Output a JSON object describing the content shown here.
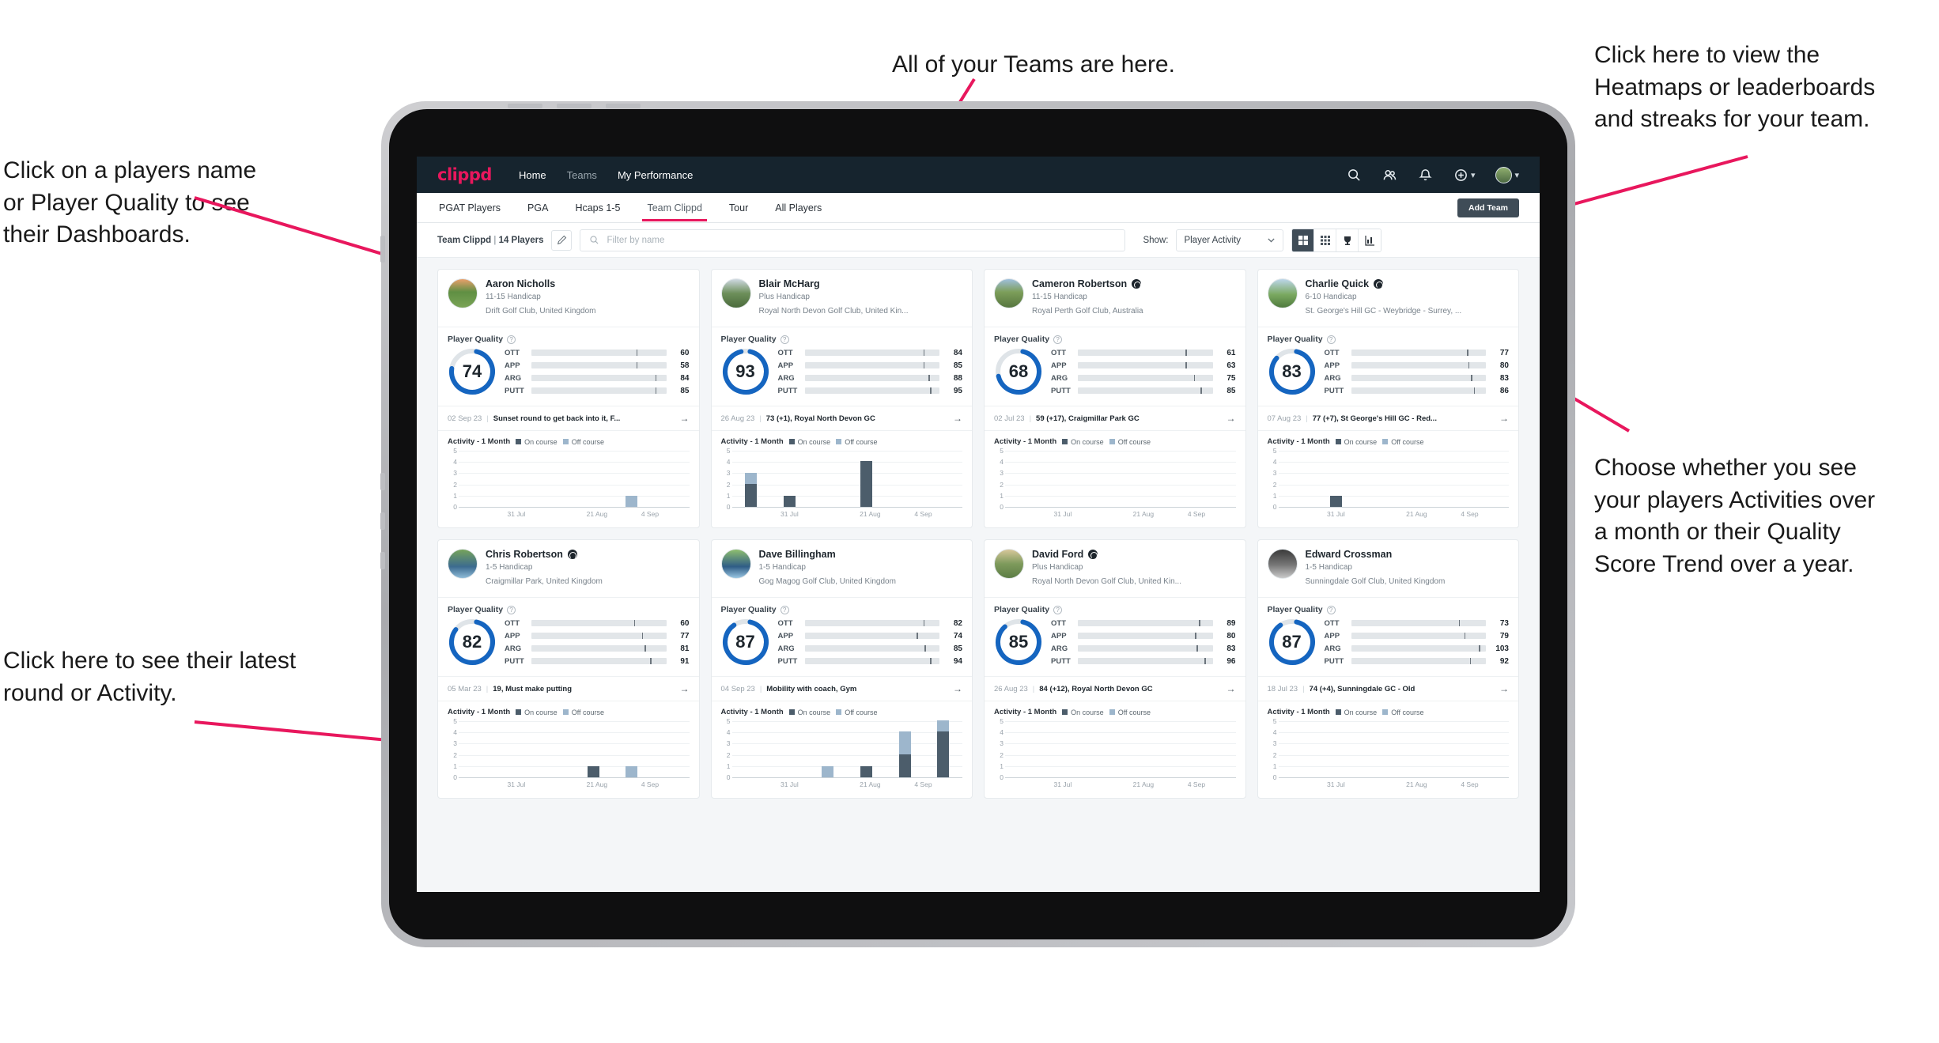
{
  "annotations": [
    {
      "id": "teams",
      "text": "All of your Teams are here."
    },
    {
      "id": "heatmaps",
      "text": "Click here to view the\nHeatmaps or leaderboards\nand streaks for your team."
    },
    {
      "id": "players",
      "text": "Click on a players name\nor Player Quality to see\ntheir Dashboards."
    },
    {
      "id": "activity-toggle",
      "text": "Choose whether you see\nyour players Activities over\na month or their Quality\nScore Trend over a year."
    },
    {
      "id": "latest-round",
      "text": "Click here to see their latest\nround or Activity."
    }
  ],
  "nav": {
    "logo": "clippd",
    "links": [
      {
        "label": "Home",
        "active": true
      },
      {
        "label": "Teams",
        "active": false
      },
      {
        "label": "My Performance",
        "active": true
      }
    ],
    "icons": [
      "search-icon",
      "people-icon",
      "bell-icon",
      "plus-circle-icon",
      "avatar"
    ]
  },
  "tabs": [
    {
      "label": "PGAT Players",
      "active": false
    },
    {
      "label": "PGA",
      "active": false
    },
    {
      "label": "Hcaps 1-5",
      "active": false
    },
    {
      "label": "Team Clippd",
      "active": true
    },
    {
      "label": "Tour",
      "active": false
    },
    {
      "label": "All Players",
      "active": false
    }
  ],
  "add_team_label": "Add Team",
  "toolbar": {
    "team_name": "Team Clippd",
    "separator": "|",
    "player_count": "14 Players",
    "search_placeholder": "Filter by name",
    "show_label": "Show:",
    "show_value": "Player Activity",
    "view_buttons": [
      "grid-large-icon",
      "grid-small-icon",
      "trophy-icon",
      "chart-icon"
    ]
  },
  "colors": {
    "accent": "#e8175d",
    "nav_bg": "#16242e",
    "donut": "#1565c0",
    "ott": "#f5a800",
    "app": "#3fd8b0",
    "arg": "#f4176b",
    "putt": "#a915c8",
    "on_course": "#4c5d6b",
    "off_course": "#9db6cc"
  },
  "section_labels": {
    "player_quality": "Player Quality",
    "activity_title": "Activity - 1 Month",
    "legend_on": "On course",
    "legend_off": "Off course"
  },
  "chart_data": {
    "type": "bar",
    "title": "Activity - 1 Month",
    "xlabel": "",
    "ylabel": "",
    "ylim": [
      0,
      5
    ],
    "yticks": [
      0,
      1,
      2,
      3,
      4,
      5
    ],
    "xticks": [
      "31 Jul",
      "21 Aug",
      "4 Sep"
    ],
    "series_names": [
      "On course",
      "Off course"
    ],
    "grid": true,
    "legend": "top"
  },
  "players": [
    {
      "name": "Aaron Nicholls",
      "verified": false,
      "handicap": "11-15 Handicap",
      "club": "Drift Golf Club, United Kingdom",
      "quality": 74,
      "metrics": [
        {
          "name": "OTT",
          "value": 60,
          "fill_pct": 60,
          "tick_pct": 78,
          "color": "#f5a800"
        },
        {
          "name": "APP",
          "value": 58,
          "fill_pct": 58,
          "tick_pct": 78,
          "color": "#3fd8b0"
        },
        {
          "name": "ARG",
          "value": 84,
          "fill_pct": 84,
          "tick_pct": 92,
          "color": "#f4176b"
        },
        {
          "name": "PUTT",
          "value": 85,
          "fill_pct": 85,
          "tick_pct": 92,
          "color": "#a915c8"
        }
      ],
      "round_date": "02 Sep 23",
      "round_text": "Sunset round to get back into it, F...",
      "bars": [
        {
          "on": 0,
          "off": 0
        },
        {
          "on": 0,
          "off": 0
        },
        {
          "on": 0,
          "off": 0
        },
        {
          "on": 0,
          "off": 0
        },
        {
          "on": 0,
          "off": 1
        },
        {
          "on": 0,
          "off": 0
        }
      ]
    },
    {
      "name": "Blair McHarg",
      "verified": false,
      "handicap": "Plus Handicap",
      "club": "Royal North Devon Golf Club, United Kin...",
      "quality": 93,
      "metrics": [
        {
          "name": "OTT",
          "value": 84,
          "fill_pct": 74,
          "tick_pct": 88,
          "color": "#f5a800"
        },
        {
          "name": "APP",
          "value": 85,
          "fill_pct": 74,
          "tick_pct": 88,
          "color": "#3fd8b0"
        },
        {
          "name": "ARG",
          "value": 88,
          "fill_pct": 84,
          "tick_pct": 92,
          "color": "#f4176b"
        },
        {
          "name": "PUTT",
          "value": 95,
          "fill_pct": 86,
          "tick_pct": 93,
          "color": "#a915c8"
        }
      ],
      "round_date": "26 Aug 23",
      "round_text": "73 (+1), Royal North Devon GC",
      "bars": [
        {
          "on": 2,
          "off": 1
        },
        {
          "on": 1,
          "off": 0
        },
        {
          "on": 0,
          "off": 0
        },
        {
          "on": 4,
          "off": 0
        },
        {
          "on": 0,
          "off": 0
        },
        {
          "on": 0,
          "off": 0
        }
      ]
    },
    {
      "name": "Cameron Robertson",
      "verified": true,
      "handicap": "11-15 Handicap",
      "club": "Royal Perth Golf Club, Australia",
      "quality": 68,
      "metrics": [
        {
          "name": "OTT",
          "value": 61,
          "fill_pct": 61,
          "tick_pct": 80,
          "color": "#f5a800"
        },
        {
          "name": "APP",
          "value": 63,
          "fill_pct": 63,
          "tick_pct": 80,
          "color": "#3fd8b0"
        },
        {
          "name": "ARG",
          "value": 75,
          "fill_pct": 72,
          "tick_pct": 86,
          "color": "#f4176b"
        },
        {
          "name": "PUTT",
          "value": 85,
          "fill_pct": 82,
          "tick_pct": 91,
          "color": "#a915c8"
        }
      ],
      "round_date": "02 Jul 23",
      "round_text": "59 (+17), Craigmillar Park GC",
      "bars": [
        {
          "on": 0,
          "off": 0
        },
        {
          "on": 0,
          "off": 0
        },
        {
          "on": 0,
          "off": 0
        },
        {
          "on": 0,
          "off": 0
        },
        {
          "on": 0,
          "off": 0
        },
        {
          "on": 0,
          "off": 0
        }
      ]
    },
    {
      "name": "Charlie Quick",
      "verified": true,
      "handicap": "6-10 Handicap",
      "club": "St. George's Hill GC - Weybridge - Surrey, ...",
      "quality": 83,
      "metrics": [
        {
          "name": "OTT",
          "value": 77,
          "fill_pct": 72,
          "tick_pct": 86,
          "color": "#f5a800"
        },
        {
          "name": "APP",
          "value": 80,
          "fill_pct": 74,
          "tick_pct": 87,
          "color": "#3fd8b0"
        },
        {
          "name": "ARG",
          "value": 83,
          "fill_pct": 78,
          "tick_pct": 89,
          "color": "#f4176b"
        },
        {
          "name": "PUTT",
          "value": 86,
          "fill_pct": 82,
          "tick_pct": 91,
          "color": "#a915c8"
        }
      ],
      "round_date": "07 Aug 23",
      "round_text": "77 (+7), St George's Hill GC - Red...",
      "bars": [
        {
          "on": 0,
          "off": 0
        },
        {
          "on": 1,
          "off": 0
        },
        {
          "on": 0,
          "off": 0
        },
        {
          "on": 0,
          "off": 0
        },
        {
          "on": 0,
          "off": 0
        },
        {
          "on": 0,
          "off": 0
        }
      ]
    },
    {
      "name": "Chris Robertson",
      "verified": true,
      "handicap": "1-5 Handicap",
      "club": "Craigmillar Park, United Kingdom",
      "quality": 82,
      "metrics": [
        {
          "name": "OTT",
          "value": 60,
          "fill_pct": 56,
          "tick_pct": 76,
          "color": "#f5a800"
        },
        {
          "name": "APP",
          "value": 77,
          "fill_pct": 66,
          "tick_pct": 82,
          "color": "#3fd8b0"
        },
        {
          "name": "ARG",
          "value": 81,
          "fill_pct": 70,
          "tick_pct": 84,
          "color": "#f4176b"
        },
        {
          "name": "PUTT",
          "value": 91,
          "fill_pct": 78,
          "tick_pct": 88,
          "color": "#a915c8"
        }
      ],
      "round_date": "05 Mar 23",
      "round_text": "19, Must make putting",
      "bars": [
        {
          "on": 0,
          "off": 0
        },
        {
          "on": 0,
          "off": 0
        },
        {
          "on": 0,
          "off": 0
        },
        {
          "on": 1,
          "off": 0
        },
        {
          "on": 0,
          "off": 1
        },
        {
          "on": 0,
          "off": 0
        }
      ]
    },
    {
      "name": "Dave Billingham",
      "verified": false,
      "handicap": "1-5 Handicap",
      "club": "Gog Magog Golf Club, United Kingdom",
      "quality": 87,
      "metrics": [
        {
          "name": "OTT",
          "value": 82,
          "fill_pct": 76,
          "tick_pct": 88,
          "color": "#f5a800"
        },
        {
          "name": "APP",
          "value": 74,
          "fill_pct": 68,
          "tick_pct": 83,
          "color": "#3fd8b0"
        },
        {
          "name": "ARG",
          "value": 85,
          "fill_pct": 78,
          "tick_pct": 89,
          "color": "#f4176b"
        },
        {
          "name": "PUTT",
          "value": 94,
          "fill_pct": 86,
          "tick_pct": 93,
          "color": "#a915c8"
        }
      ],
      "round_date": "04 Sep 23",
      "round_text": "Mobility with coach, Gym",
      "bars": [
        {
          "on": 0,
          "off": 0
        },
        {
          "on": 0,
          "off": 0
        },
        {
          "on": 0,
          "off": 1
        },
        {
          "on": 1,
          "off": 0
        },
        {
          "on": 2,
          "off": 2
        },
        {
          "on": 4,
          "off": 1
        }
      ]
    },
    {
      "name": "David Ford",
      "verified": true,
      "handicap": "Plus Handicap",
      "club": "Royal North Devon Golf Club, United Kin...",
      "quality": 85,
      "metrics": [
        {
          "name": "OTT",
          "value": 89,
          "fill_pct": 80,
          "tick_pct": 90,
          "color": "#f5a800"
        },
        {
          "name": "APP",
          "value": 80,
          "fill_pct": 74,
          "tick_pct": 87,
          "color": "#3fd8b0"
        },
        {
          "name": "ARG",
          "value": 83,
          "fill_pct": 76,
          "tick_pct": 88,
          "color": "#f4176b"
        },
        {
          "name": "PUTT",
          "value": 96,
          "fill_pct": 88,
          "tick_pct": 94,
          "color": "#a915c8"
        }
      ],
      "round_date": "26 Aug 23",
      "round_text": "84 (+12), Royal North Devon GC",
      "bars": [
        {
          "on": 0,
          "off": 0
        },
        {
          "on": 0,
          "off": 0
        },
        {
          "on": 0,
          "off": 0
        },
        {
          "on": 0,
          "off": 0
        },
        {
          "on": 0,
          "off": 0
        },
        {
          "on": 0,
          "off": 0
        }
      ]
    },
    {
      "name": "Edward Crossman",
      "verified": false,
      "handicap": "1-5 Handicap",
      "club": "Sunningdale Golf Club, United Kingdom",
      "quality": 87,
      "metrics": [
        {
          "name": "OTT",
          "value": 73,
          "fill_pct": 64,
          "tick_pct": 80,
          "color": "#f5a800"
        },
        {
          "name": "APP",
          "value": 79,
          "fill_pct": 70,
          "tick_pct": 84,
          "color": "#3fd8b0"
        },
        {
          "name": "ARG",
          "value": 103,
          "fill_pct": 88,
          "tick_pct": 95,
          "color": "#f4176b"
        },
        {
          "name": "PUTT",
          "value": 92,
          "fill_pct": 78,
          "tick_pct": 88,
          "color": "#a915c8"
        }
      ],
      "round_date": "18 Jul 23",
      "round_text": "74 (+4), Sunningdale GC - Old",
      "bars": [
        {
          "on": 0,
          "off": 0
        },
        {
          "on": 0,
          "off": 0
        },
        {
          "on": 0,
          "off": 0
        },
        {
          "on": 0,
          "off": 0
        },
        {
          "on": 0,
          "off": 0
        },
        {
          "on": 0,
          "off": 0
        }
      ]
    }
  ]
}
